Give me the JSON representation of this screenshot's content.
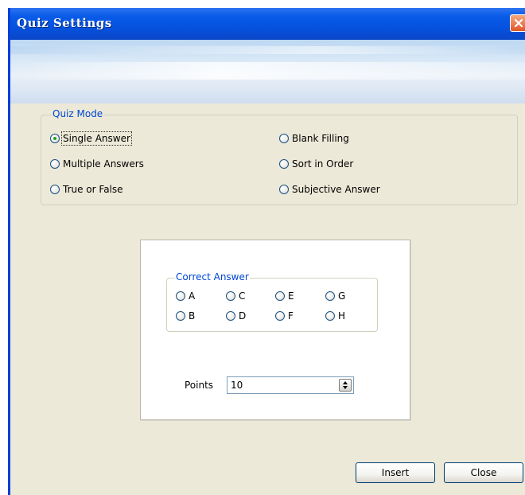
{
  "window": {
    "title": "Quiz Settings"
  },
  "quiz_mode": {
    "legend": "Quiz Mode",
    "options": [
      {
        "label": "Single Answer",
        "selected": true
      },
      {
        "label": "Blank Filling",
        "selected": false
      },
      {
        "label": "Multiple Answers",
        "selected": false
      },
      {
        "label": "Sort in Order",
        "selected": false
      },
      {
        "label": "True or False",
        "selected": false
      },
      {
        "label": "Subjective Answer",
        "selected": false
      }
    ]
  },
  "correct_answer": {
    "legend": "Correct Answer",
    "options": [
      "A",
      "C",
      "E",
      "G",
      "B",
      "D",
      "F",
      "H"
    ]
  },
  "points": {
    "label": "Points",
    "value": "10"
  },
  "buttons": {
    "insert": "Insert",
    "close": "Close"
  },
  "colors": {
    "title_bar": "#0552DF",
    "dialog_bg": "#ECE9D8",
    "legend_text": "#0046D5",
    "selected_dot": "#21A121",
    "close_button": "#E0562A"
  }
}
